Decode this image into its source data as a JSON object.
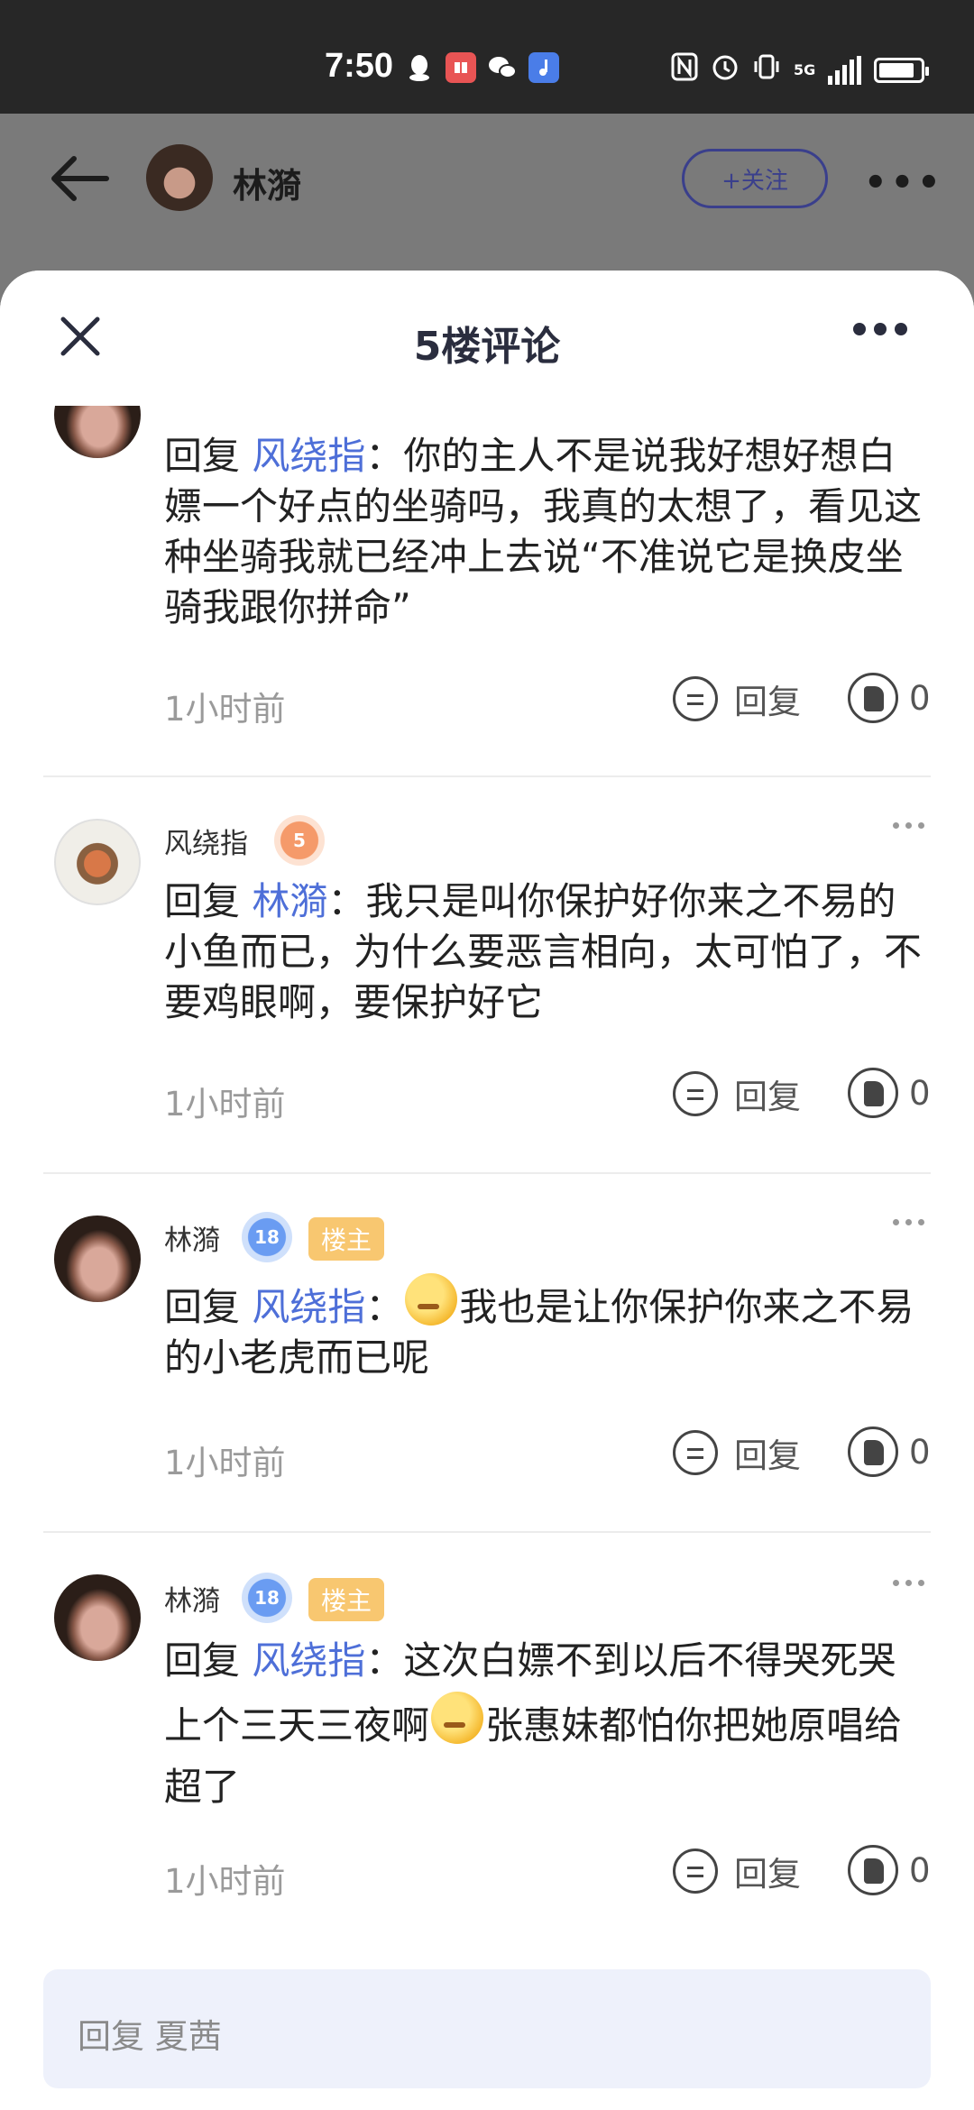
{
  "status_bar": {
    "time": "7:50",
    "network": "5G",
    "icons": [
      "qq-icon",
      "book-icon",
      "wechat-icon",
      "music-icon",
      "nfc-icon",
      "alarm-icon",
      "vibrate-icon",
      "signal-icon",
      "battery-charging-icon"
    ]
  },
  "header": {
    "user_name": "林漪",
    "follow_label": "+关注",
    "more": "•••"
  },
  "sheet": {
    "title": "5楼评论"
  },
  "comments": [
    {
      "reply_word": "回复",
      "mention": "风绕指",
      "text": "：你的主人不是说我好想好想白嫖一个好点的坐骑吗，我真的太想了，看见这种坐骑我就已经冲上去说“不准说它是换皮坐骑我跟你拼命”",
      "time": "1小时前",
      "reply_label": "回复",
      "likes": "0"
    },
    {
      "user": "风绕指",
      "level": "5",
      "reply_word": "回复",
      "mention": "林漪",
      "text": "：我只是叫你保护好你来之不易的小鱼而已，为什么要恶言相向，太可怕了，不要鸡眼啊，要保护好它",
      "time": "1小时前",
      "reply_label": "回复",
      "likes": "0"
    },
    {
      "user": "林漪",
      "level": "18",
      "badge": "楼主",
      "reply_word": "回复",
      "mention": "风绕指",
      "text_before": "：",
      "text_after": "我也是让你保护你来之不易的小老虎而已呢",
      "time": "1小时前",
      "reply_label": "回复",
      "likes": "0"
    },
    {
      "user": "林漪",
      "level": "18",
      "badge": "楼主",
      "reply_word": "回复",
      "mention": "风绕指",
      "text_before": "：这次白嫖不到以后不得哭死哭上个三天三夜啊",
      "text_after": "张惠妹都怕你把她原唱给超了",
      "time": "1小时前",
      "reply_label": "回复",
      "likes": "0"
    }
  ],
  "input": {
    "placeholder": "回复 夏茜"
  },
  "colors": {
    "mention": "#4e6fd8",
    "badge": "#f8c770",
    "follow": "#3a3f8c",
    "input_bg": "#eef1fb"
  }
}
